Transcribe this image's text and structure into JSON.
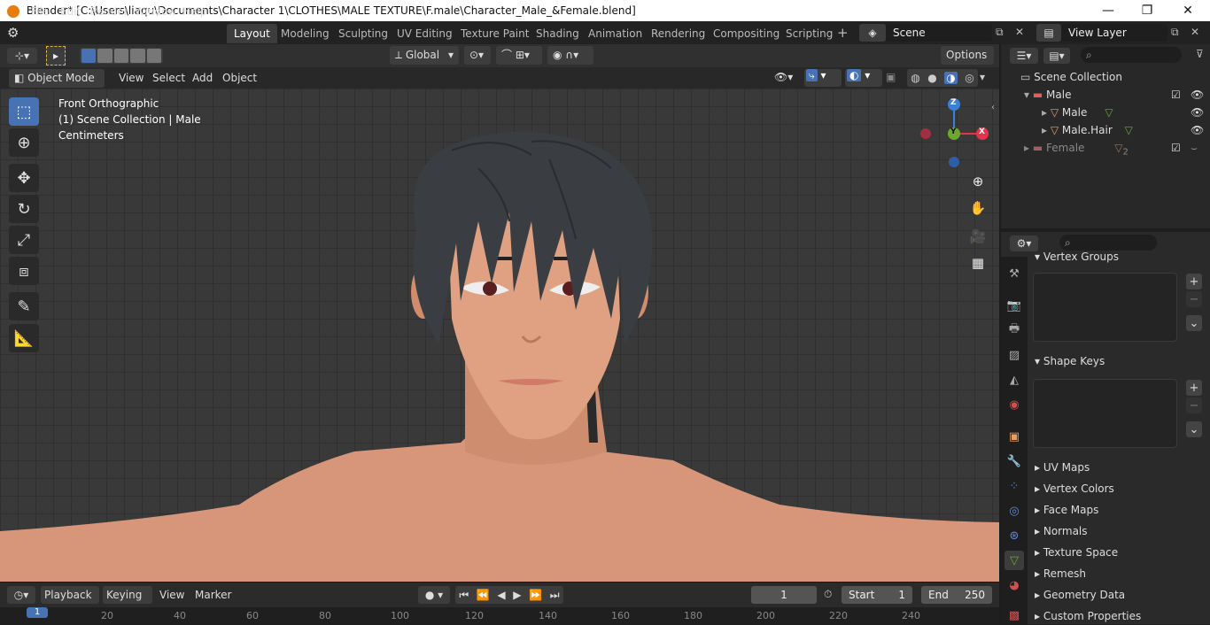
{
  "window": {
    "title": "Blender* [C:\\Users\\liaqu\\Documents\\Character 1\\CLOTHES\\MALE TEXTURE\\F.male\\Character_Male_&Female.blend]",
    "minimize": "—",
    "maximize": "❐",
    "close": "✕"
  },
  "menu": {
    "file": "File",
    "edit": "Edit",
    "render": "Render",
    "window": "Window",
    "help": "Help"
  },
  "workspaces": [
    "Layout",
    "Modeling",
    "Sculpting",
    "UV Editing",
    "Texture Paint",
    "Shading",
    "Animation",
    "Rendering",
    "Compositing",
    "Scripting"
  ],
  "workspace_add": "+",
  "scene": {
    "name": "Scene",
    "view_layer": "View Layer"
  },
  "viewport_header": {
    "transform_orientation": "Global",
    "options": "Options",
    "mode": "Object Mode",
    "view": "View",
    "select": "Select",
    "add": "Add",
    "object": "Object"
  },
  "viewport_info": {
    "line1": "Front Orthographic",
    "line2": "(1) Scene Collection | Male",
    "line3": "Centimeters"
  },
  "gizmo": {
    "z": "Z",
    "y": "Y",
    "x": "X"
  },
  "outliner": {
    "root": "Scene Collection",
    "items": [
      {
        "label": "Male"
      },
      {
        "label": "Male"
      },
      {
        "label": "Male.Hair"
      },
      {
        "label": "Female",
        "badge": "2"
      }
    ]
  },
  "properties": {
    "partial_panel": "Vertex Groups",
    "shape_keys": "Shape Keys",
    "panels": [
      "UV Maps",
      "Vertex Colors",
      "Face Maps",
      "Normals",
      "Texture Space",
      "Remesh",
      "Geometry Data",
      "Custom Properties"
    ],
    "add": "+",
    "remove": "−",
    "menu": "⌄"
  },
  "timeline": {
    "playback": "Playback",
    "keying": "Keying",
    "view": "View",
    "marker": "Marker",
    "current_frame": "1",
    "start_label": "Start",
    "start": "1",
    "end_label": "End",
    "end": "250",
    "current_marker": "1",
    "ticks": [
      "20",
      "40",
      "60",
      "80",
      "100",
      "120",
      "140",
      "160",
      "180",
      "200",
      "220",
      "240"
    ]
  },
  "colors": {
    "accent": "#4772b3",
    "x_axis": "#e5334a",
    "y_axis": "#6ca82e",
    "z_axis": "#3b7fd9",
    "skin": "#d89a77",
    "hair": "#3a3d42"
  }
}
